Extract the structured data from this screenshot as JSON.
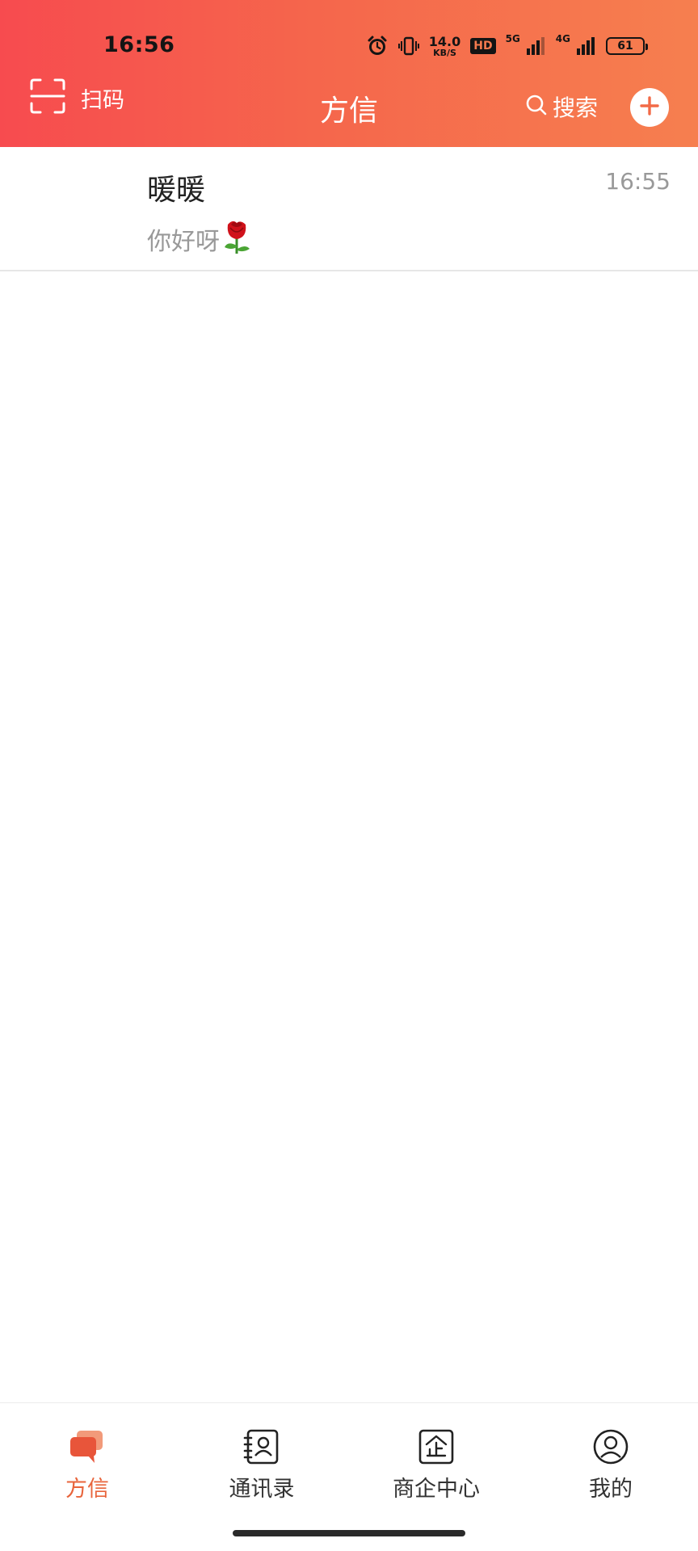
{
  "status_bar": {
    "time": "16:56",
    "net_speed_value": "14.0",
    "net_speed_unit": "KB/S",
    "hd_label": "HD",
    "network_5g": "5G",
    "network_4g": "4G",
    "battery": "61",
    "icons": [
      "alarm-icon",
      "vibrate-icon",
      "signal-icon",
      "battery-icon"
    ]
  },
  "header": {
    "scan_label": "扫码",
    "title": "方信",
    "search_label": "搜索",
    "add_icon": "plus-icon"
  },
  "conversations": [
    {
      "name": "暖暖",
      "time": "16:55",
      "preview": "你好呀",
      "preview_emoji": "rose-emoji"
    }
  ],
  "tabs": [
    {
      "label": "方信",
      "icon": "chat-icon",
      "active": true
    },
    {
      "label": "通讯录",
      "icon": "contacts-book-icon",
      "active": false
    },
    {
      "label": "商企中心",
      "icon": "enterprise-icon",
      "active": false
    },
    {
      "label": "我的",
      "icon": "profile-icon",
      "active": false
    }
  ],
  "colors": {
    "header_gradient_start": "#f74b4f",
    "header_gradient_end": "#f67f4f",
    "accent": "#e8643b",
    "secondary_text": "#999999"
  }
}
